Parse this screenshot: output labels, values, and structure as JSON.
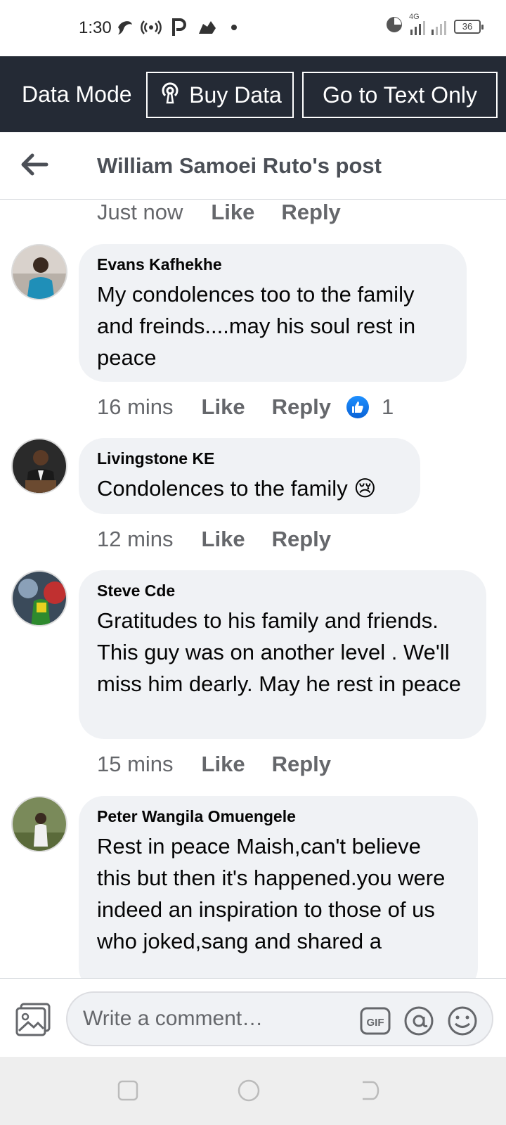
{
  "status_bar": {
    "time": "1:30",
    "network": "4G",
    "battery": "36"
  },
  "data_bar": {
    "mode_label": "Data Mode",
    "buy_data_label": "Buy Data",
    "text_only_label": "Go to Text Only"
  },
  "header": {
    "title": "William Samoei Ruto's post"
  },
  "top_meta": {
    "time": "Just now",
    "like": "Like",
    "reply": "Reply"
  },
  "comments": [
    {
      "author": "Evans Kafhekhe",
      "text": "My condolences too to the family and freinds....may his soul rest in peace",
      "time": "16 mins",
      "like": "Like",
      "reply": "Reply",
      "reaction_count": "1"
    },
    {
      "author": "Livingstone KE",
      "text": "Condolences to the family 😢",
      "time": "12 mins",
      "like": "Like",
      "reply": "Reply"
    },
    {
      "author": "Steve Cde",
      "text": "Gratitudes to his family and friends. This guy was on another level . We'll miss him dearly. May he rest in peace",
      "time": "15 mins",
      "like": "Like",
      "reply": "Reply"
    },
    {
      "author": "Peter Wangila Omuengele",
      "text": "Rest in peace Maish,can't believe this but then it's happened.you were indeed an inspiration to those of us who joked,sang and shared a"
    }
  ],
  "composer": {
    "placeholder": "Write a comment…"
  },
  "colors": {
    "data_bar_bg": "#242a35",
    "bubble_bg": "#f0f2f5",
    "meta_text": "#65676b",
    "like_blue": "#1877f2"
  }
}
